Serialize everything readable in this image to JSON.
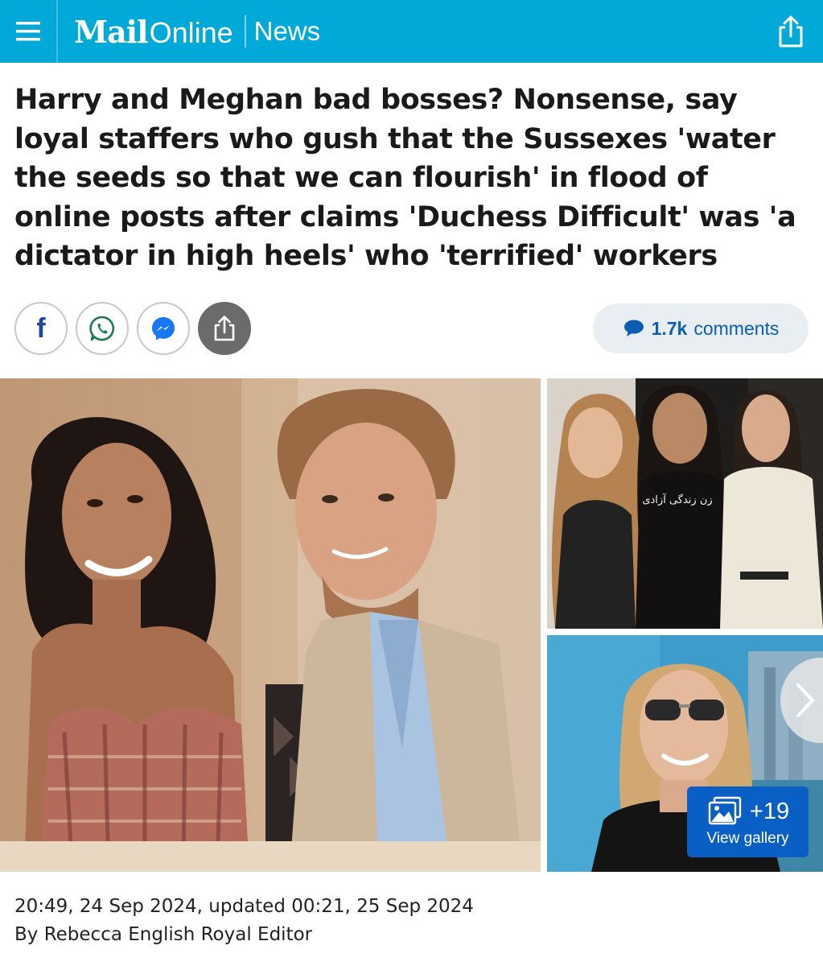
{
  "header": {
    "brand_mail": "Mail",
    "brand_online": "Online",
    "section": "News",
    "accent": "#00a9d8"
  },
  "article": {
    "headline": "Harry and Meghan bad bosses? Nonsense, say loyal staffers who gush that the Sussexes 'water the seeds so that we can flourish' in flood of online posts after claims 'Duchess Difficult' was 'a dictator in high heels' who 'terrified' workers",
    "date": "20:49, 24 Sep 2024, updated 00:21, 25 Sep 2024",
    "byline": "By Rebecca English Royal Editor"
  },
  "share": {
    "facebook_letter": "f",
    "icons": [
      "facebook-icon",
      "whatsapp-icon",
      "messenger-icon",
      "share-icon"
    ]
  },
  "comments": {
    "count": "1.7k",
    "label": "comments"
  },
  "gallery": {
    "count": "+19",
    "label": "View gallery"
  },
  "photos": {
    "shirt_text": "زن زندگی آزادی"
  }
}
